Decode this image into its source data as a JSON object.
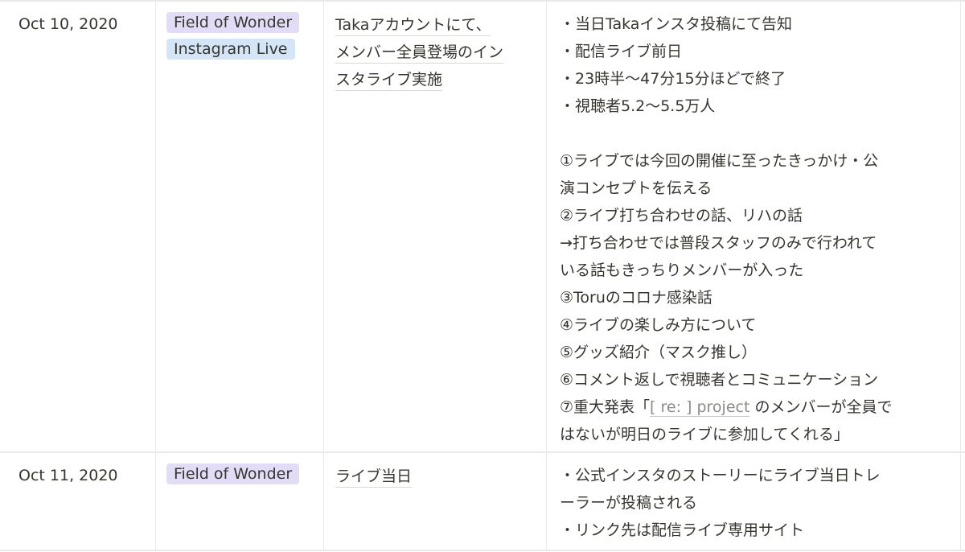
{
  "colors": {
    "tag_purple": "#e3dcf7",
    "tag_blue": "#d3e5f6",
    "border": "#e9e9e7",
    "text": "#37352f",
    "mention": "#8a8a86"
  },
  "rows": [
    {
      "date": "Oct 10, 2020",
      "tags": [
        {
          "label": "Field of Wonder",
          "color": "purple"
        },
        {
          "label": "Instagram Live",
          "color": "blue"
        }
      ],
      "title_lines": [
        "Takaアカウントにて、",
        "メンバー全員登場のイン",
        "スタライブ実施"
      ],
      "notes": {
        "bullets": [
          "・当日Takaインスタ投稿にて告知",
          "・配信ライブ前日",
          "・23時半〜47分15分ほどで終了",
          "・視聴者5.2〜5.5万人"
        ],
        "items": [
          "①ライブでは今回の開催に至ったきっかけ・公",
          "演コンセプトを伝える",
          "②ライブ打ち合わせの話、リハの話",
          "→打ち合わせでは普段スタッフのみで行われて",
          "いる話もきっちりメンバーが入った",
          "③Toruのコロナ感染話",
          "④ライブの楽しみ方について",
          "⑤グッズ紹介（マスク推し）",
          "⑥コメント返しで視聴者とコミュニケーション"
        ],
        "item7_prefix": "⑦重大発表「",
        "item7_mention": "[ re: ] project",
        "item7_suffix": " のメンバーが全員で",
        "item7_line2": "はないが明日のライブに参加してくれる」"
      }
    },
    {
      "date": "Oct 11, 2020",
      "tags": [
        {
          "label": "Field of Wonder",
          "color": "purple"
        }
      ],
      "title_lines": [
        "ライブ当日"
      ],
      "notes": {
        "bullets": [
          "・公式インスタのストーリーにライブ当日トレ",
          "ーラーが投稿される",
          "・リンク先は配信ライブ専用サイト"
        ]
      }
    }
  ]
}
